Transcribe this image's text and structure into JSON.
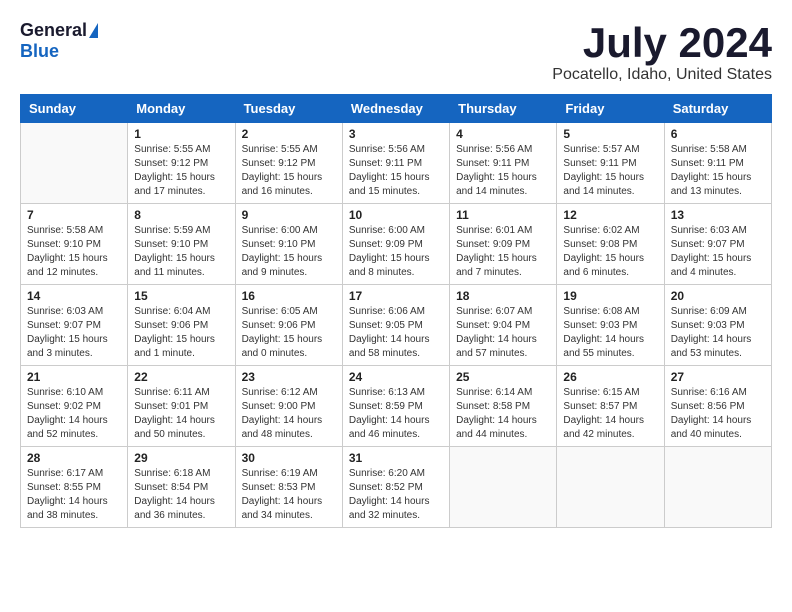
{
  "logo": {
    "general": "General",
    "blue": "Blue"
  },
  "title": {
    "month": "July 2024",
    "location": "Pocatello, Idaho, United States"
  },
  "headers": [
    "Sunday",
    "Monday",
    "Tuesday",
    "Wednesday",
    "Thursday",
    "Friday",
    "Saturday"
  ],
  "weeks": [
    [
      {
        "day": "",
        "info": ""
      },
      {
        "day": "1",
        "info": "Sunrise: 5:55 AM\nSunset: 9:12 PM\nDaylight: 15 hours\nand 17 minutes."
      },
      {
        "day": "2",
        "info": "Sunrise: 5:55 AM\nSunset: 9:12 PM\nDaylight: 15 hours\nand 16 minutes."
      },
      {
        "day": "3",
        "info": "Sunrise: 5:56 AM\nSunset: 9:11 PM\nDaylight: 15 hours\nand 15 minutes."
      },
      {
        "day": "4",
        "info": "Sunrise: 5:56 AM\nSunset: 9:11 PM\nDaylight: 15 hours\nand 14 minutes."
      },
      {
        "day": "5",
        "info": "Sunrise: 5:57 AM\nSunset: 9:11 PM\nDaylight: 15 hours\nand 14 minutes."
      },
      {
        "day": "6",
        "info": "Sunrise: 5:58 AM\nSunset: 9:11 PM\nDaylight: 15 hours\nand 13 minutes."
      }
    ],
    [
      {
        "day": "7",
        "info": "Sunrise: 5:58 AM\nSunset: 9:10 PM\nDaylight: 15 hours\nand 12 minutes."
      },
      {
        "day": "8",
        "info": "Sunrise: 5:59 AM\nSunset: 9:10 PM\nDaylight: 15 hours\nand 11 minutes."
      },
      {
        "day": "9",
        "info": "Sunrise: 6:00 AM\nSunset: 9:10 PM\nDaylight: 15 hours\nand 9 minutes."
      },
      {
        "day": "10",
        "info": "Sunrise: 6:00 AM\nSunset: 9:09 PM\nDaylight: 15 hours\nand 8 minutes."
      },
      {
        "day": "11",
        "info": "Sunrise: 6:01 AM\nSunset: 9:09 PM\nDaylight: 15 hours\nand 7 minutes."
      },
      {
        "day": "12",
        "info": "Sunrise: 6:02 AM\nSunset: 9:08 PM\nDaylight: 15 hours\nand 6 minutes."
      },
      {
        "day": "13",
        "info": "Sunrise: 6:03 AM\nSunset: 9:07 PM\nDaylight: 15 hours\nand 4 minutes."
      }
    ],
    [
      {
        "day": "14",
        "info": "Sunrise: 6:03 AM\nSunset: 9:07 PM\nDaylight: 15 hours\nand 3 minutes."
      },
      {
        "day": "15",
        "info": "Sunrise: 6:04 AM\nSunset: 9:06 PM\nDaylight: 15 hours\nand 1 minute."
      },
      {
        "day": "16",
        "info": "Sunrise: 6:05 AM\nSunset: 9:06 PM\nDaylight: 15 hours\nand 0 minutes."
      },
      {
        "day": "17",
        "info": "Sunrise: 6:06 AM\nSunset: 9:05 PM\nDaylight: 14 hours\nand 58 minutes."
      },
      {
        "day": "18",
        "info": "Sunrise: 6:07 AM\nSunset: 9:04 PM\nDaylight: 14 hours\nand 57 minutes."
      },
      {
        "day": "19",
        "info": "Sunrise: 6:08 AM\nSunset: 9:03 PM\nDaylight: 14 hours\nand 55 minutes."
      },
      {
        "day": "20",
        "info": "Sunrise: 6:09 AM\nSunset: 9:03 PM\nDaylight: 14 hours\nand 53 minutes."
      }
    ],
    [
      {
        "day": "21",
        "info": "Sunrise: 6:10 AM\nSunset: 9:02 PM\nDaylight: 14 hours\nand 52 minutes."
      },
      {
        "day": "22",
        "info": "Sunrise: 6:11 AM\nSunset: 9:01 PM\nDaylight: 14 hours\nand 50 minutes."
      },
      {
        "day": "23",
        "info": "Sunrise: 6:12 AM\nSunset: 9:00 PM\nDaylight: 14 hours\nand 48 minutes."
      },
      {
        "day": "24",
        "info": "Sunrise: 6:13 AM\nSunset: 8:59 PM\nDaylight: 14 hours\nand 46 minutes."
      },
      {
        "day": "25",
        "info": "Sunrise: 6:14 AM\nSunset: 8:58 PM\nDaylight: 14 hours\nand 44 minutes."
      },
      {
        "day": "26",
        "info": "Sunrise: 6:15 AM\nSunset: 8:57 PM\nDaylight: 14 hours\nand 42 minutes."
      },
      {
        "day": "27",
        "info": "Sunrise: 6:16 AM\nSunset: 8:56 PM\nDaylight: 14 hours\nand 40 minutes."
      }
    ],
    [
      {
        "day": "28",
        "info": "Sunrise: 6:17 AM\nSunset: 8:55 PM\nDaylight: 14 hours\nand 38 minutes."
      },
      {
        "day": "29",
        "info": "Sunrise: 6:18 AM\nSunset: 8:54 PM\nDaylight: 14 hours\nand 36 minutes."
      },
      {
        "day": "30",
        "info": "Sunrise: 6:19 AM\nSunset: 8:53 PM\nDaylight: 14 hours\nand 34 minutes."
      },
      {
        "day": "31",
        "info": "Sunrise: 6:20 AM\nSunset: 8:52 PM\nDaylight: 14 hours\nand 32 minutes."
      },
      {
        "day": "",
        "info": ""
      },
      {
        "day": "",
        "info": ""
      },
      {
        "day": "",
        "info": ""
      }
    ]
  ]
}
